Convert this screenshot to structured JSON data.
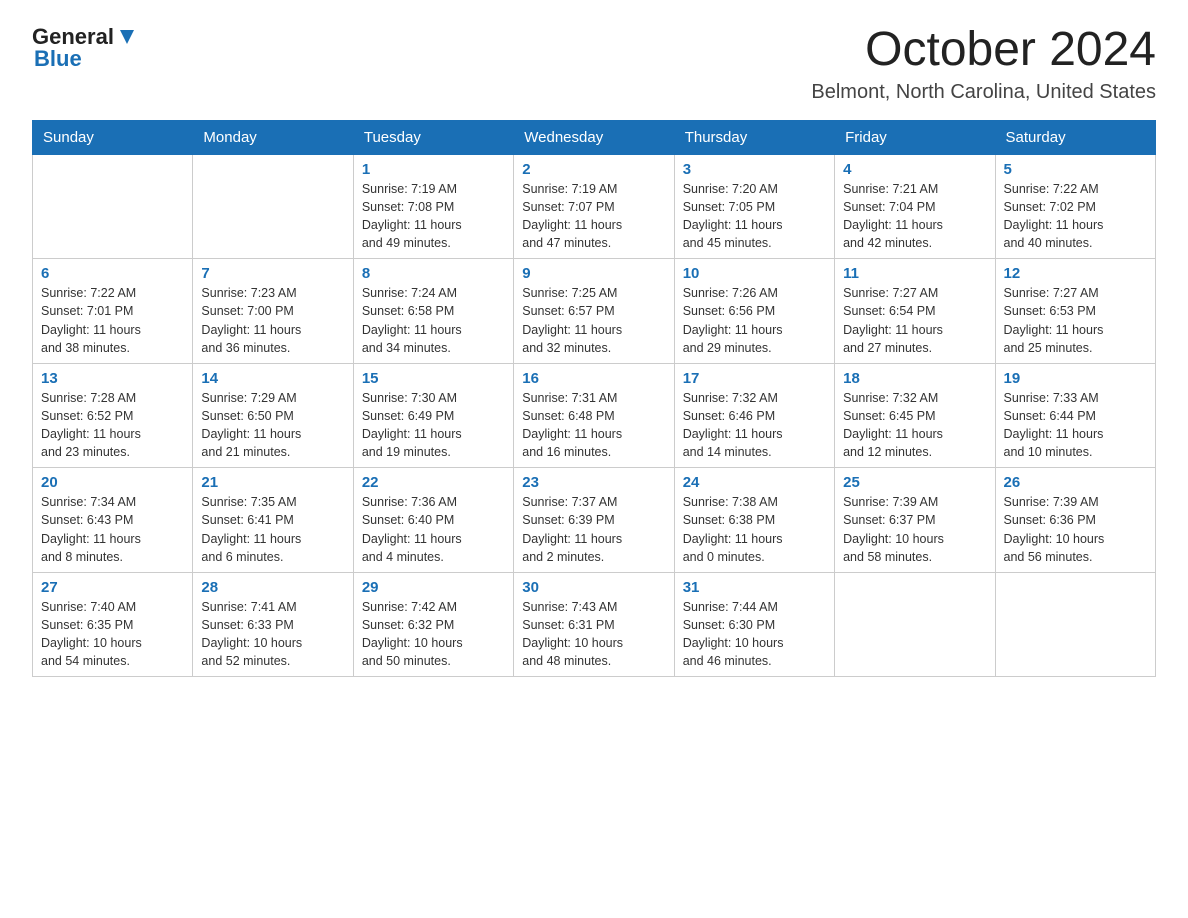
{
  "header": {
    "logo_general": "General",
    "logo_blue": "Blue",
    "title": "October 2024",
    "subtitle": "Belmont, North Carolina, United States"
  },
  "days_of_week": [
    "Sunday",
    "Monday",
    "Tuesday",
    "Wednesday",
    "Thursday",
    "Friday",
    "Saturday"
  ],
  "weeks": [
    [
      {
        "day": "",
        "info": ""
      },
      {
        "day": "",
        "info": ""
      },
      {
        "day": "1",
        "info": "Sunrise: 7:19 AM\nSunset: 7:08 PM\nDaylight: 11 hours\nand 49 minutes."
      },
      {
        "day": "2",
        "info": "Sunrise: 7:19 AM\nSunset: 7:07 PM\nDaylight: 11 hours\nand 47 minutes."
      },
      {
        "day": "3",
        "info": "Sunrise: 7:20 AM\nSunset: 7:05 PM\nDaylight: 11 hours\nand 45 minutes."
      },
      {
        "day": "4",
        "info": "Sunrise: 7:21 AM\nSunset: 7:04 PM\nDaylight: 11 hours\nand 42 minutes."
      },
      {
        "day": "5",
        "info": "Sunrise: 7:22 AM\nSunset: 7:02 PM\nDaylight: 11 hours\nand 40 minutes."
      }
    ],
    [
      {
        "day": "6",
        "info": "Sunrise: 7:22 AM\nSunset: 7:01 PM\nDaylight: 11 hours\nand 38 minutes."
      },
      {
        "day": "7",
        "info": "Sunrise: 7:23 AM\nSunset: 7:00 PM\nDaylight: 11 hours\nand 36 minutes."
      },
      {
        "day": "8",
        "info": "Sunrise: 7:24 AM\nSunset: 6:58 PM\nDaylight: 11 hours\nand 34 minutes."
      },
      {
        "day": "9",
        "info": "Sunrise: 7:25 AM\nSunset: 6:57 PM\nDaylight: 11 hours\nand 32 minutes."
      },
      {
        "day": "10",
        "info": "Sunrise: 7:26 AM\nSunset: 6:56 PM\nDaylight: 11 hours\nand 29 minutes."
      },
      {
        "day": "11",
        "info": "Sunrise: 7:27 AM\nSunset: 6:54 PM\nDaylight: 11 hours\nand 27 minutes."
      },
      {
        "day": "12",
        "info": "Sunrise: 7:27 AM\nSunset: 6:53 PM\nDaylight: 11 hours\nand 25 minutes."
      }
    ],
    [
      {
        "day": "13",
        "info": "Sunrise: 7:28 AM\nSunset: 6:52 PM\nDaylight: 11 hours\nand 23 minutes."
      },
      {
        "day": "14",
        "info": "Sunrise: 7:29 AM\nSunset: 6:50 PM\nDaylight: 11 hours\nand 21 minutes."
      },
      {
        "day": "15",
        "info": "Sunrise: 7:30 AM\nSunset: 6:49 PM\nDaylight: 11 hours\nand 19 minutes."
      },
      {
        "day": "16",
        "info": "Sunrise: 7:31 AM\nSunset: 6:48 PM\nDaylight: 11 hours\nand 16 minutes."
      },
      {
        "day": "17",
        "info": "Sunrise: 7:32 AM\nSunset: 6:46 PM\nDaylight: 11 hours\nand 14 minutes."
      },
      {
        "day": "18",
        "info": "Sunrise: 7:32 AM\nSunset: 6:45 PM\nDaylight: 11 hours\nand 12 minutes."
      },
      {
        "day": "19",
        "info": "Sunrise: 7:33 AM\nSunset: 6:44 PM\nDaylight: 11 hours\nand 10 minutes."
      }
    ],
    [
      {
        "day": "20",
        "info": "Sunrise: 7:34 AM\nSunset: 6:43 PM\nDaylight: 11 hours\nand 8 minutes."
      },
      {
        "day": "21",
        "info": "Sunrise: 7:35 AM\nSunset: 6:41 PM\nDaylight: 11 hours\nand 6 minutes."
      },
      {
        "day": "22",
        "info": "Sunrise: 7:36 AM\nSunset: 6:40 PM\nDaylight: 11 hours\nand 4 minutes."
      },
      {
        "day": "23",
        "info": "Sunrise: 7:37 AM\nSunset: 6:39 PM\nDaylight: 11 hours\nand 2 minutes."
      },
      {
        "day": "24",
        "info": "Sunrise: 7:38 AM\nSunset: 6:38 PM\nDaylight: 11 hours\nand 0 minutes."
      },
      {
        "day": "25",
        "info": "Sunrise: 7:39 AM\nSunset: 6:37 PM\nDaylight: 10 hours\nand 58 minutes."
      },
      {
        "day": "26",
        "info": "Sunrise: 7:39 AM\nSunset: 6:36 PM\nDaylight: 10 hours\nand 56 minutes."
      }
    ],
    [
      {
        "day": "27",
        "info": "Sunrise: 7:40 AM\nSunset: 6:35 PM\nDaylight: 10 hours\nand 54 minutes."
      },
      {
        "day": "28",
        "info": "Sunrise: 7:41 AM\nSunset: 6:33 PM\nDaylight: 10 hours\nand 52 minutes."
      },
      {
        "day": "29",
        "info": "Sunrise: 7:42 AM\nSunset: 6:32 PM\nDaylight: 10 hours\nand 50 minutes."
      },
      {
        "day": "30",
        "info": "Sunrise: 7:43 AM\nSunset: 6:31 PM\nDaylight: 10 hours\nand 48 minutes."
      },
      {
        "day": "31",
        "info": "Sunrise: 7:44 AM\nSunset: 6:30 PM\nDaylight: 10 hours\nand 46 minutes."
      },
      {
        "day": "",
        "info": ""
      },
      {
        "day": "",
        "info": ""
      }
    ]
  ]
}
